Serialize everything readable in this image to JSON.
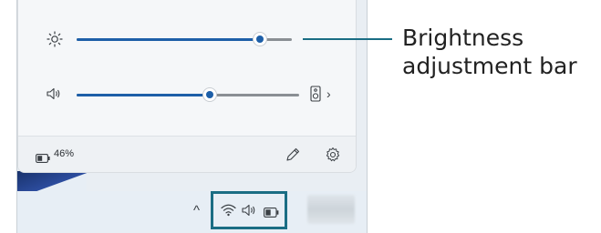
{
  "quick_settings": {
    "brightness": {
      "icon": "sun-icon",
      "level": 0.85
    },
    "volume": {
      "icon": "speaker-icon",
      "level": 0.6,
      "output_device_icon": "speaker-device-icon",
      "more_chevron": "›"
    },
    "battery": {
      "icon": "battery-icon",
      "percent_label": "46%"
    },
    "edit_icon": "pencil-icon",
    "settings_icon": "gear-icon"
  },
  "taskbar": {
    "overflow_chevron": "^",
    "tray_icons": [
      "wifi-icon",
      "speaker-icon",
      "battery-icon"
    ]
  },
  "callout": {
    "line1": "Brightness",
    "line2": "adjustment bar"
  },
  "colors": {
    "accent": "#1d5fa8",
    "callout": "#1a6d84"
  }
}
